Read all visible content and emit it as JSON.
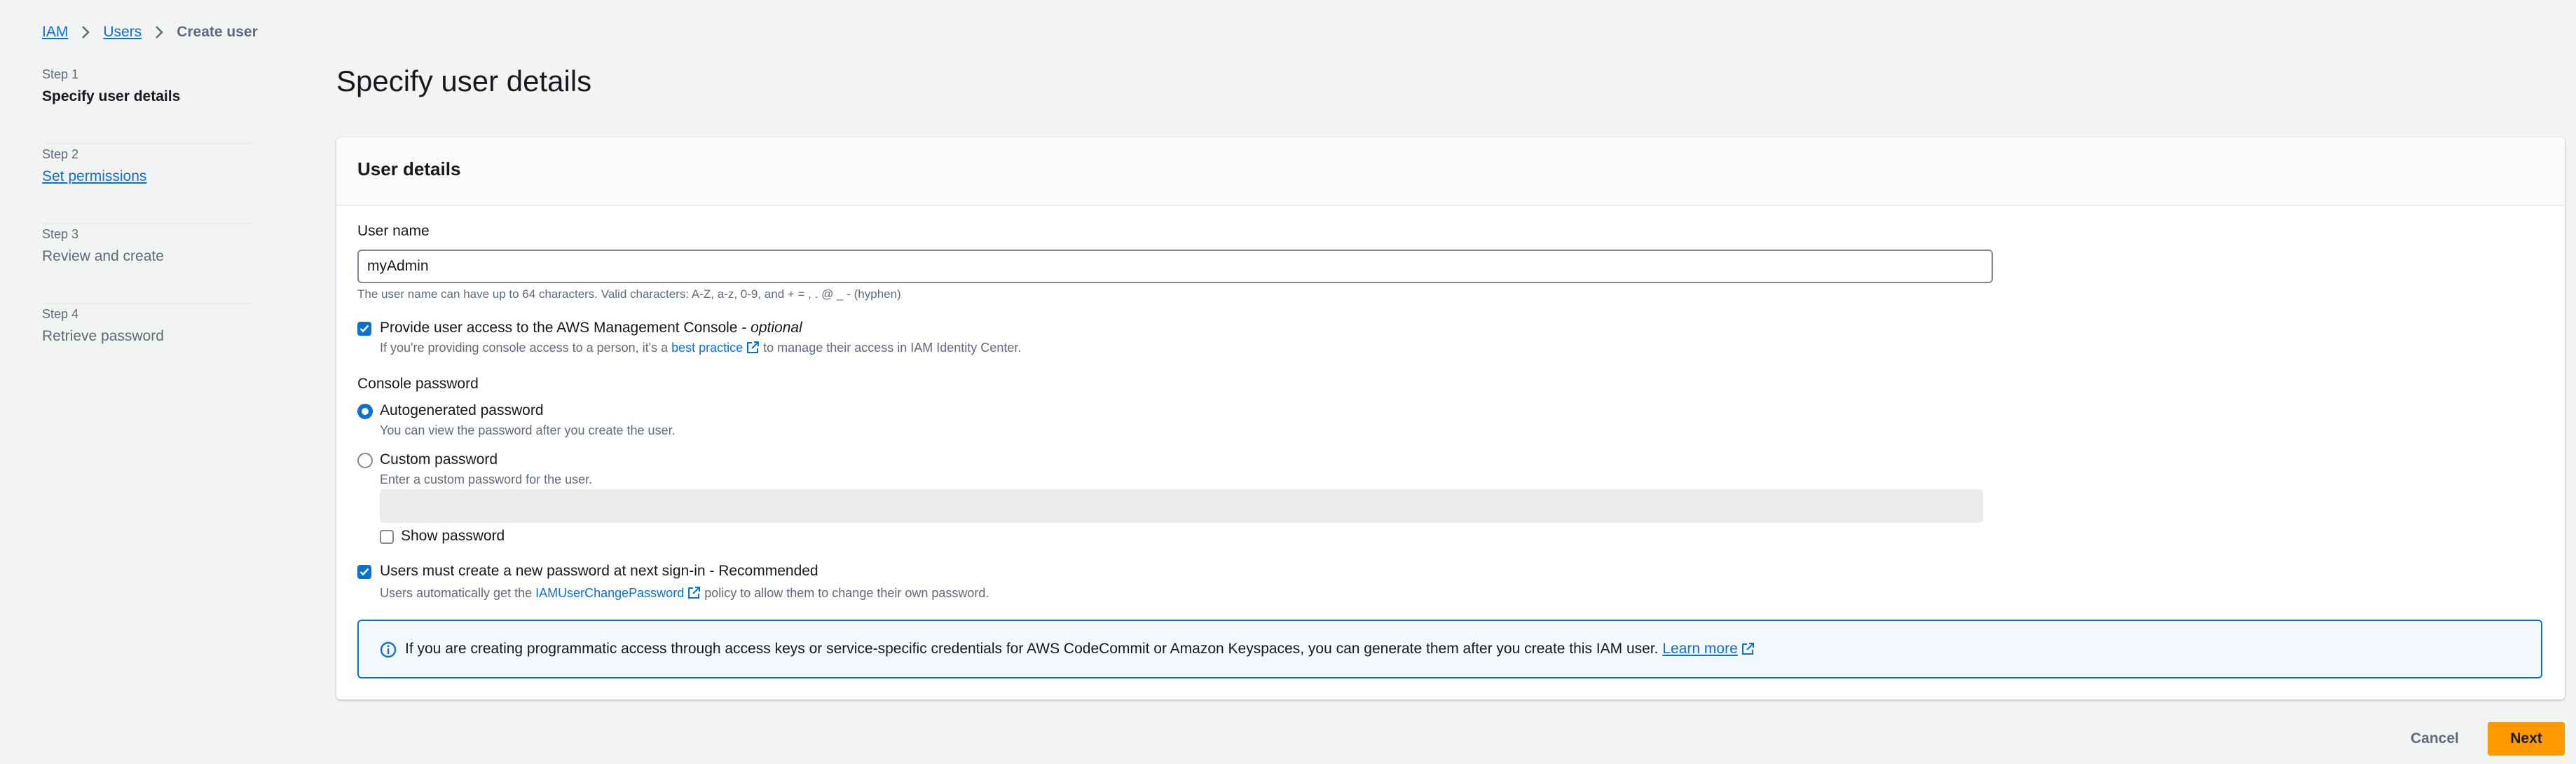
{
  "breadcrumb": {
    "items": [
      {
        "label": "IAM"
      },
      {
        "label": "Users"
      }
    ],
    "current": "Create user"
  },
  "steps": [
    {
      "number": "Step 1",
      "title": "Specify user details",
      "state": "active"
    },
    {
      "number": "Step 2",
      "title": "Set permissions",
      "state": "link"
    },
    {
      "number": "Step 3",
      "title": "Review and create",
      "state": "disabled"
    },
    {
      "number": "Step 4",
      "title": "Retrieve password",
      "state": "disabled"
    }
  ],
  "page": {
    "title": "Specify user details"
  },
  "user_details": {
    "heading": "User details",
    "username_label": "User name",
    "username_value": "myAdmin",
    "username_hint": "The user name can have up to 64 characters. Valid characters: A-Z, a-z, 0-9, and + = , . @ _ - (hyphen)",
    "console_access": {
      "label": "Provide user access to the AWS Management Console - ",
      "optional": "optional",
      "checked": true,
      "hint_prefix": "If you're providing console access to a person, it's a ",
      "hint_link": "best practice",
      "hint_suffix": " to manage their access in IAM Identity Center."
    },
    "console_password": {
      "label": "Console password",
      "options": [
        {
          "label": "Autogenerated password",
          "desc": "You can view the password after you create the user.",
          "selected": true
        },
        {
          "label": "Custom password",
          "desc": "Enter a custom password for the user.",
          "selected": false
        }
      ],
      "custom_value": "",
      "show_password_label": "Show password",
      "show_password_checked": false
    },
    "reset_required": {
      "label": "Users must create a new password at next sign-in - Recommended",
      "checked": true,
      "hint_prefix": "Users automatically get the ",
      "hint_link": "IAMUserChangePassword",
      "hint_suffix": " policy to allow them to change their own password."
    },
    "info": {
      "text": "If you are creating programmatic access through access keys or service-specific credentials for AWS CodeCommit or Amazon Keyspaces, you can generate them after you create this IAM user.",
      "link": "Learn more"
    }
  },
  "actions": {
    "cancel": "Cancel",
    "next": "Next"
  },
  "colors": {
    "accent": "#0972d3",
    "primary_button": "#ff9900",
    "background": "#f2f3f3"
  }
}
